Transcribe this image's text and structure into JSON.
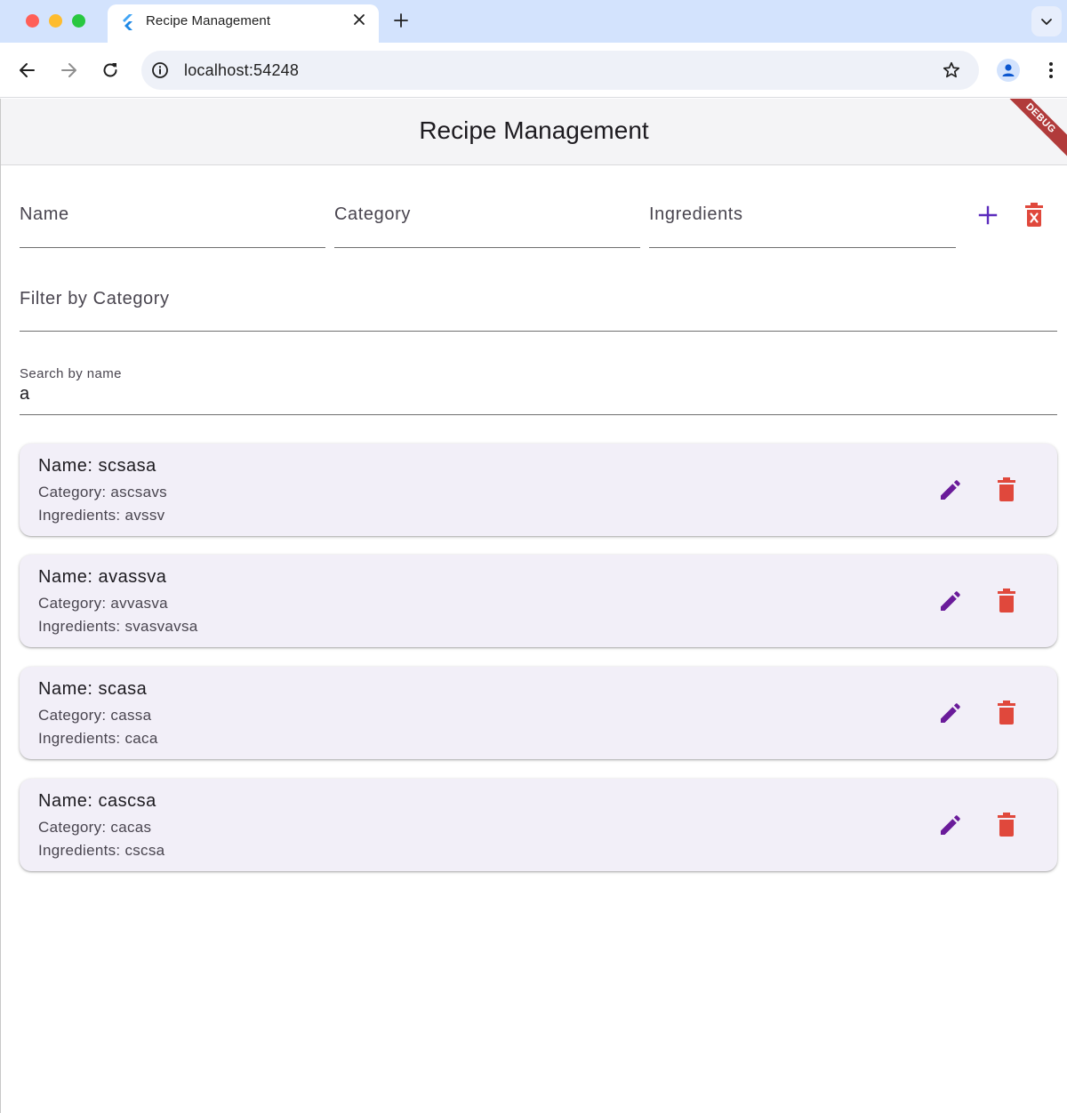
{
  "browser": {
    "tab_title": "Recipe Management",
    "url": "localhost:54248"
  },
  "app": {
    "title": "Recipe Management",
    "debug_banner": "DEBUG",
    "form": {
      "name_label": "Name",
      "category_label": "Category",
      "ingredients_label": "Ingredients"
    },
    "filter": {
      "label": "Filter by Category"
    },
    "search": {
      "label": "Search by name",
      "value": "a"
    },
    "recipes": [
      {
        "name": "Name: scsasa",
        "category": "Category: ascsavs",
        "ingredients": "Ingredients: avssv"
      },
      {
        "name": "Name: avassva",
        "category": "Category: avvasva",
        "ingredients": "Ingredients: svasvavsa"
      },
      {
        "name": "Name: scasa",
        "category": "Category: cassa",
        "ingredients": "Ingredients: caca"
      },
      {
        "name": "Name: cascsa",
        "category": "Category: cacas",
        "ingredients": "Ingredients: cscsa"
      }
    ],
    "colors": {
      "primary": "#6a1b9a",
      "add_icon": "#5b2bbd",
      "delete": "#e0483c",
      "card_bg": "#f2eff8"
    }
  }
}
